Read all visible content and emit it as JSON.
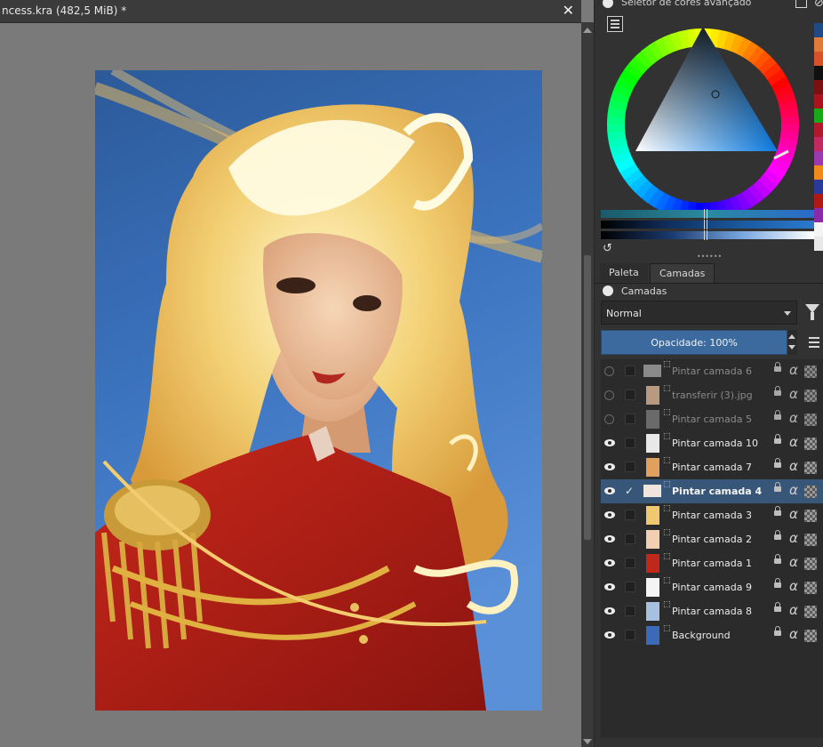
{
  "document": {
    "title": "ncess.kra (482,5 MiB) *",
    "close_label": "✕"
  },
  "color_selector": {
    "title": "Seletor de cores avançado",
    "swatches": [
      "#1f4a86",
      "#e07a3a",
      "#d6522c",
      "#101010",
      "#7a1010",
      "#a8141c",
      "#18a81a",
      "#b0182c",
      "#c02a60",
      "#9a3ab0",
      "#f08a18",
      "#2a3a9a",
      "#b01818",
      "#8a2aa8",
      "#f4f4f4",
      "#e8e8e8"
    ]
  },
  "layers_panel": {
    "tabs": [
      "Paleta",
      "Camadas"
    ],
    "active_tab": "Camadas",
    "title": "Camadas",
    "blend_mode": "Normal",
    "opacity_label": "Opacidade:  100%",
    "layers": [
      {
        "name": "Pintar camada 6",
        "visible": false,
        "selected": false,
        "thumb": "wide",
        "thumb_color": "#8a8a8a"
      },
      {
        "name": "transferir (3).jpg",
        "visible": false,
        "selected": false,
        "thumb": "tall",
        "thumb_color": "#b89a80"
      },
      {
        "name": "Pintar camada 5",
        "visible": false,
        "selected": false,
        "thumb": "tall",
        "thumb_color": "#6a6a6a"
      },
      {
        "name": "Pintar camada 10",
        "visible": true,
        "selected": false,
        "thumb": "tall",
        "thumb_color": "#e8e8e8"
      },
      {
        "name": "Pintar camada 7",
        "visible": true,
        "selected": false,
        "thumb": "tall",
        "thumb_color": "#e0a060"
      },
      {
        "name": "Pintar camada 4",
        "visible": true,
        "selected": true,
        "thumb": "wide",
        "thumb_color": "#f0e4dc"
      },
      {
        "name": "Pintar camada 3",
        "visible": true,
        "selected": false,
        "thumb": "tall",
        "thumb_color": "#f0c870"
      },
      {
        "name": "Pintar camada 2",
        "visible": true,
        "selected": false,
        "thumb": "tall",
        "thumb_color": "#f0d0b0"
      },
      {
        "name": "Pintar camada 1",
        "visible": true,
        "selected": false,
        "thumb": "tall",
        "thumb_color": "#c0281c"
      },
      {
        "name": "Pintar camada 9",
        "visible": true,
        "selected": false,
        "thumb": "tall",
        "thumb_color": "#f4f4f4"
      },
      {
        "name": "Pintar camada 8",
        "visible": true,
        "selected": false,
        "thumb": "tall",
        "thumb_color": "#a8c0e0"
      },
      {
        "name": "Background",
        "visible": true,
        "selected": false,
        "thumb": "tall",
        "thumb_color": "#3a6ab8"
      }
    ]
  },
  "colors": {
    "accent": "#3d6a9e",
    "selected_row": "#385778",
    "canvas_bg": "#7a7a7a"
  }
}
